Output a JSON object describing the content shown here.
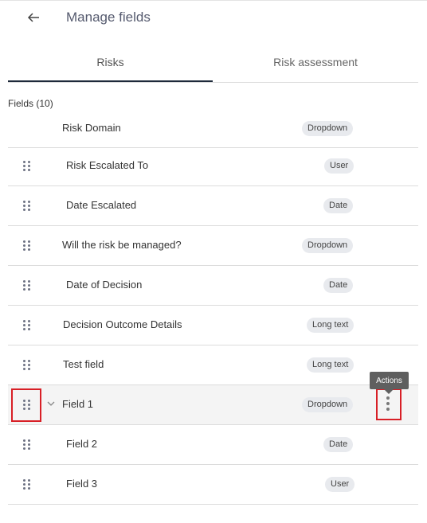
{
  "header": {
    "back_icon": "arrow-left-icon",
    "title": "Manage fields"
  },
  "tabs": [
    {
      "label": "Risks",
      "active": true
    },
    {
      "label": "Risk assessment",
      "active": false
    }
  ],
  "fields_count": "Fields (10)",
  "fields": [
    {
      "name": "Risk Domain",
      "type": "Dropdown",
      "draggable": false
    },
    {
      "name": "Risk Escalated To",
      "type": "User",
      "draggable": true
    },
    {
      "name": "Date Escalated",
      "type": "Date",
      "draggable": true
    },
    {
      "name": "Will the risk be managed?",
      "type": "Dropdown",
      "draggable": true
    },
    {
      "name": "Date of Decision",
      "type": "Date",
      "draggable": true
    },
    {
      "name": "Decision Outcome Details",
      "type": "Long text",
      "draggable": true
    },
    {
      "name": "Test field",
      "type": "Long text",
      "draggable": true
    },
    {
      "name": "Field 1",
      "type": "Dropdown",
      "draggable": true,
      "expandable": true,
      "highlighted": true
    },
    {
      "name": "Field 2",
      "type": "Date",
      "draggable": true
    },
    {
      "name": "Field 3",
      "type": "User",
      "draggable": true
    }
  ],
  "tooltip": "Actions",
  "colors": {
    "accent": "#1e2a3b",
    "highlight_box": "#d81f26",
    "badge_bg": "#e8eaee",
    "tooltip_bg": "#5f5f5f"
  }
}
